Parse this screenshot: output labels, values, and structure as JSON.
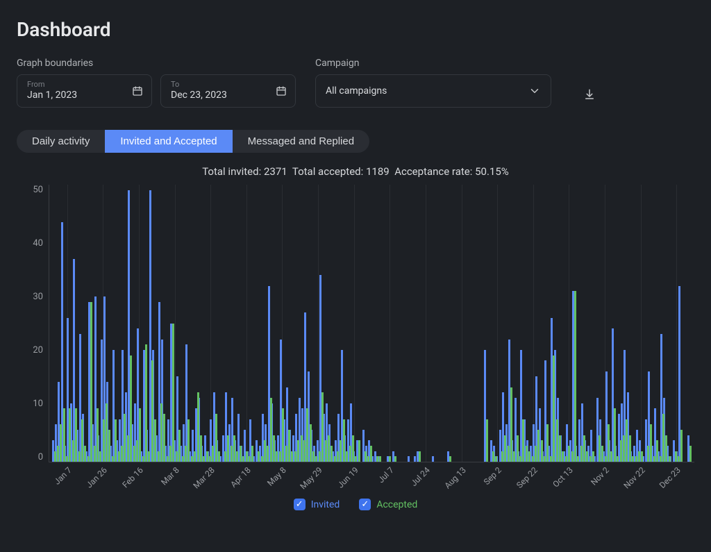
{
  "title": "Dashboard",
  "boundaries_label": "Graph boundaries",
  "from_label": "From",
  "from_value": "Jan 1, 2023",
  "to_label": "To",
  "to_value": "Dec 23, 2023",
  "campaign_label": "Campaign",
  "campaign_value": "All campaigns",
  "tabs": {
    "daily": "Daily activity",
    "invited": "Invited and Accepted",
    "messaged": "Messaged and Replied",
    "active": "invited"
  },
  "summary": {
    "total_invited_label": "Total invited:",
    "total_invited": 2371,
    "total_accepted_label": "Total accepted:",
    "total_accepted": 1189,
    "acceptance_rate_label": "Acceptance rate:",
    "acceptance_rate": "50.15%"
  },
  "legend": {
    "invited": "Invited",
    "accepted": "Accepted"
  },
  "colors": {
    "invited": "#5b8af6",
    "accepted": "#63c162",
    "tab_active": "#5b8af6",
    "bg": "#1d2025"
  },
  "chart_data": {
    "type": "bar",
    "ylim": [
      0,
      52
    ],
    "yticks": [
      0,
      10,
      20,
      30,
      40,
      50
    ],
    "xlabel": "",
    "ylabel": "",
    "xticks": [
      "Jan 7",
      "Jan 26",
      "Feb 16",
      "Mar 8",
      "Mar 28",
      "Apr 18",
      "May 8",
      "May 29",
      "Jun 19",
      "Jul 7",
      "Jul 24",
      "Aug 13",
      "Sep 2",
      "Sep 22",
      "Oct 13",
      "Nov 2",
      "Nov 22",
      "Dec 23"
    ],
    "series": [
      {
        "name": "Invited",
        "color": "#5b8af6",
        "values": [
          0,
          4,
          7,
          15,
          45,
          3,
          27,
          11,
          38,
          6,
          24,
          9,
          2,
          30,
          7,
          31,
          5,
          23,
          31,
          15,
          3,
          21,
          4,
          8,
          21,
          13,
          51,
          7,
          11,
          25,
          2,
          21,
          6,
          51,
          21,
          5,
          30,
          23,
          3,
          8,
          26,
          4,
          16,
          3,
          7,
          22,
          2,
          6,
          10,
          12,
          3,
          5,
          2,
          8,
          13,
          4,
          1,
          5,
          13,
          7,
          12,
          4,
          9,
          3,
          6,
          2,
          8,
          1,
          4,
          3,
          9,
          7,
          33,
          11,
          4,
          5,
          23,
          8,
          14,
          6,
          5,
          9,
          12,
          10,
          28,
          17,
          6,
          3,
          4,
          35,
          9,
          11,
          7,
          2,
          4,
          9,
          21,
          5,
          8,
          11,
          2,
          4,
          0,
          6,
          3,
          4,
          1,
          2,
          1,
          0,
          0,
          1,
          0,
          2,
          0,
          0,
          0,
          0,
          1,
          0,
          1,
          2,
          0,
          0,
          0,
          0,
          1,
          0,
          0,
          0,
          0,
          2,
          0,
          0,
          0,
          0,
          0,
          0,
          0,
          0,
          0,
          0,
          0,
          21,
          0,
          4,
          3,
          1,
          6,
          13,
          7,
          23,
          4,
          12,
          2,
          21,
          8,
          4,
          3,
          7,
          16,
          10,
          2,
          19,
          3,
          27,
          21,
          12,
          5,
          2,
          7,
          4,
          32,
          3,
          8,
          11,
          4,
          3,
          6,
          1,
          12,
          8,
          2,
          17,
          4,
          25,
          3,
          9,
          11,
          21,
          13,
          2,
          3,
          6,
          4,
          1,
          8,
          17,
          3,
          10,
          2,
          24,
          12,
          3,
          1,
          4,
          2,
          33,
          0,
          0,
          5,
          0
        ],
        "total": 2371
      },
      {
        "name": "Accepted",
        "color": "#63c162",
        "values": [
          0,
          2,
          3,
          7,
          10,
          1,
          10,
          4,
          10,
          2,
          8,
          3,
          1,
          30,
          3,
          10,
          2,
          8,
          11,
          6,
          1,
          8,
          2,
          3,
          9,
          5,
          20,
          3,
          4,
          10,
          1,
          22,
          2,
          19,
          8,
          2,
          11,
          9,
          1,
          3,
          26,
          2,
          6,
          1,
          3,
          8,
          1,
          2,
          13,
          5,
          1,
          2,
          1,
          3,
          9,
          2,
          0,
          2,
          5,
          3,
          5,
          2,
          3,
          1,
          2,
          1,
          3,
          0,
          2,
          1,
          4,
          3,
          12,
          5,
          2,
          2,
          10,
          3,
          6,
          2,
          2,
          4,
          5,
          4,
          10,
          7,
          2,
          1,
          2,
          13,
          4,
          5,
          3,
          1,
          2,
          4,
          8,
          2,
          3,
          5,
          1,
          4,
          0,
          2,
          1,
          3,
          0,
          1,
          1,
          0,
          0,
          1,
          0,
          1,
          0,
          0,
          0,
          0,
          0,
          0,
          0,
          2,
          0,
          0,
          0,
          0,
          0,
          0,
          0,
          0,
          0,
          1,
          0,
          0,
          0,
          0,
          0,
          0,
          0,
          0,
          0,
          0,
          0,
          8,
          0,
          2,
          1,
          0,
          2,
          5,
          3,
          14,
          2,
          5,
          1,
          8,
          3,
          2,
          1,
          3,
          6,
          4,
          1,
          7,
          1,
          20,
          8,
          5,
          2,
          1,
          3,
          2,
          32,
          1,
          3,
          5,
          2,
          1,
          2,
          0,
          5,
          3,
          1,
          7,
          2,
          10,
          1,
          4,
          5,
          8,
          5,
          1,
          1,
          2,
          2,
          0,
          3,
          7,
          1,
          4,
          1,
          9,
          5,
          1,
          0,
          2,
          1,
          6,
          0,
          0,
          3,
          0
        ],
        "total": 1189
      }
    ]
  }
}
